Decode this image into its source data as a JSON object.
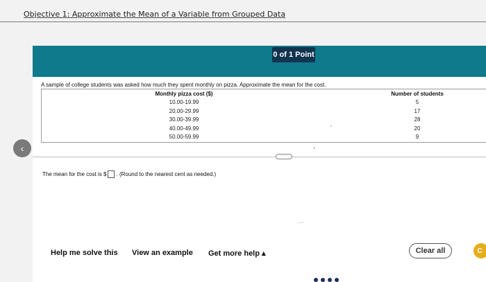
{
  "header": {
    "objective": "Objective 1: Approximate the Mean of a Variable from Grouped Data"
  },
  "banner": {
    "points": "0 of 1 Point"
  },
  "question": {
    "prompt": "A sample of college students was asked how much they spent monthly on pizza. Approximate the mean for the cost.",
    "table": {
      "col1_header": "Monthly pizza cost ($)",
      "col2_header": "Number of students",
      "rows": [
        {
          "cost": "10.00-19.99",
          "students": "5"
        },
        {
          "cost": "20.00-29.99",
          "students": "17"
        },
        {
          "cost": "30.00-39.99",
          "students": "28"
        },
        {
          "cost": "40.00-49.99",
          "students": "20"
        },
        {
          "cost": "50.00-59.99",
          "students": "9"
        }
      ]
    },
    "more_button": "·····",
    "answer_prefix": "The mean for the cost is $",
    "answer_value": "",
    "answer_suffix": ". (Round to the nearest cent as needed.)"
  },
  "footer": {
    "help_me_solve": "Help me solve this",
    "view_example": "View an example",
    "get_more_help": "Get more help ▴",
    "clear_all": "Clear all",
    "next_label": "C"
  },
  "colors": {
    "banner": "#0f7a8c",
    "points_badge": "#11344f",
    "next_button": "#e6ad1d"
  },
  "icons": {
    "back": "chevron-left-icon"
  }
}
